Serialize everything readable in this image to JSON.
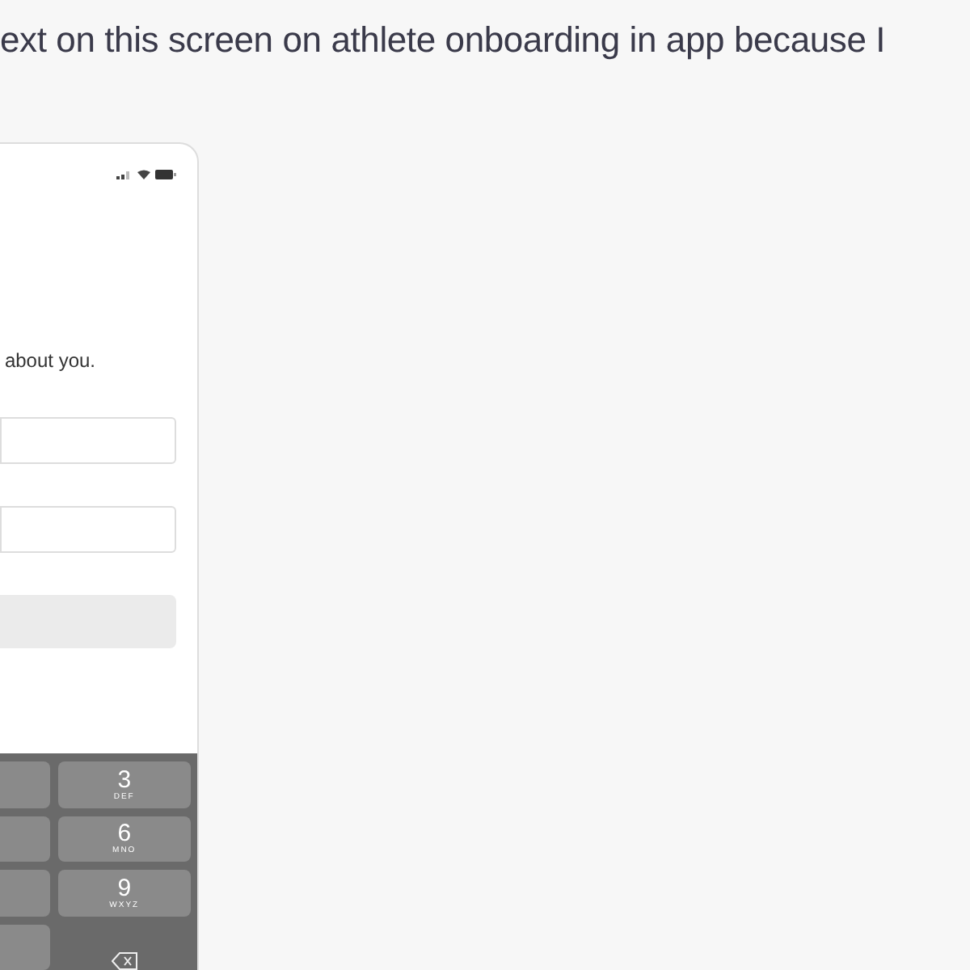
{
  "message": {
    "text": "ext on this screen on athlete onboarding in app because I"
  },
  "phone": {
    "prompt": "about you.",
    "fields": [
      {
        "kind": "text"
      },
      {
        "kind": "text"
      }
    ],
    "button": {
      "disabled": true
    },
    "keypad": [
      [
        {
          "kind": "blank"
        },
        {
          "kind": "digit",
          "digit": "3",
          "letters": "DEF"
        }
      ],
      [
        {
          "kind": "blank"
        },
        {
          "kind": "digit",
          "digit": "6",
          "letters": "MNO"
        }
      ],
      [
        {
          "kind": "blank"
        },
        {
          "kind": "digit",
          "digit": "9",
          "letters": "WXYZ"
        }
      ],
      [
        {
          "kind": "blank"
        },
        {
          "kind": "delete"
        }
      ]
    ]
  }
}
